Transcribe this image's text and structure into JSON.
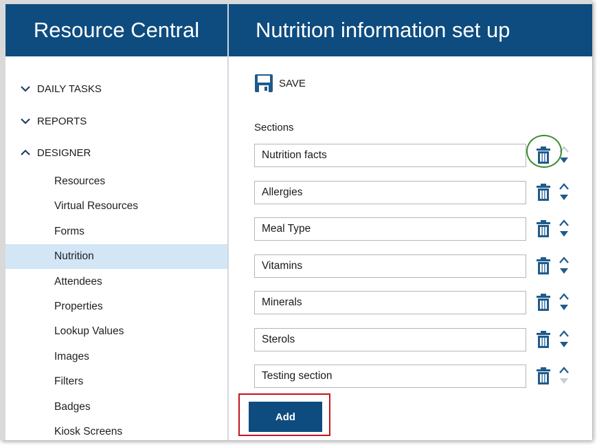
{
  "header": {
    "app_title": "Resource Central",
    "page_title": "Nutrition information set up"
  },
  "sidebar": {
    "sections": [
      {
        "label": "DAILY TASKS",
        "state": "collapsed",
        "icon": "chevron-down-icon"
      },
      {
        "label": "REPORTS",
        "state": "collapsed",
        "icon": "chevron-down-icon"
      },
      {
        "label": "DESIGNER",
        "state": "expanded",
        "icon": "chevron-up-icon"
      }
    ],
    "items": [
      {
        "label": "Resources"
      },
      {
        "label": "Virtual Resources"
      },
      {
        "label": "Forms"
      },
      {
        "label": "Nutrition",
        "active": true
      },
      {
        "label": "Attendees"
      },
      {
        "label": "Properties"
      },
      {
        "label": "Lookup Values"
      },
      {
        "label": "Images"
      },
      {
        "label": "Filters"
      },
      {
        "label": "Badges"
      },
      {
        "label": "Kiosk Screens"
      }
    ]
  },
  "toolbar": {
    "save_label": "SAVE",
    "save_icon": "floppy-disk-icon"
  },
  "main": {
    "sections_label": "Sections",
    "sections": [
      {
        "value": "Nutrition facts",
        "up_enabled": false,
        "down_enabled": true,
        "highlighted": true
      },
      {
        "value": "Allergies",
        "up_enabled": true,
        "down_enabled": true
      },
      {
        "value": "Meal Type",
        "up_enabled": true,
        "down_enabled": true
      },
      {
        "value": "Vitamins",
        "up_enabled": true,
        "down_enabled": true
      },
      {
        "value": "Minerals",
        "up_enabled": true,
        "down_enabled": true
      },
      {
        "value": "Sterols",
        "up_enabled": true,
        "down_enabled": true
      },
      {
        "value": "Testing section",
        "up_enabled": true,
        "down_enabled": false
      }
    ],
    "add_label": "Add"
  },
  "colors": {
    "header_blue": "#0e4c7f",
    "active_nav": "#d2e6f6",
    "icon_blue": "#1f5a8c",
    "disabled_arrow": "#c7cdd3",
    "highlight_green": "#3c8c2e",
    "callout_red": "#c0141a"
  }
}
